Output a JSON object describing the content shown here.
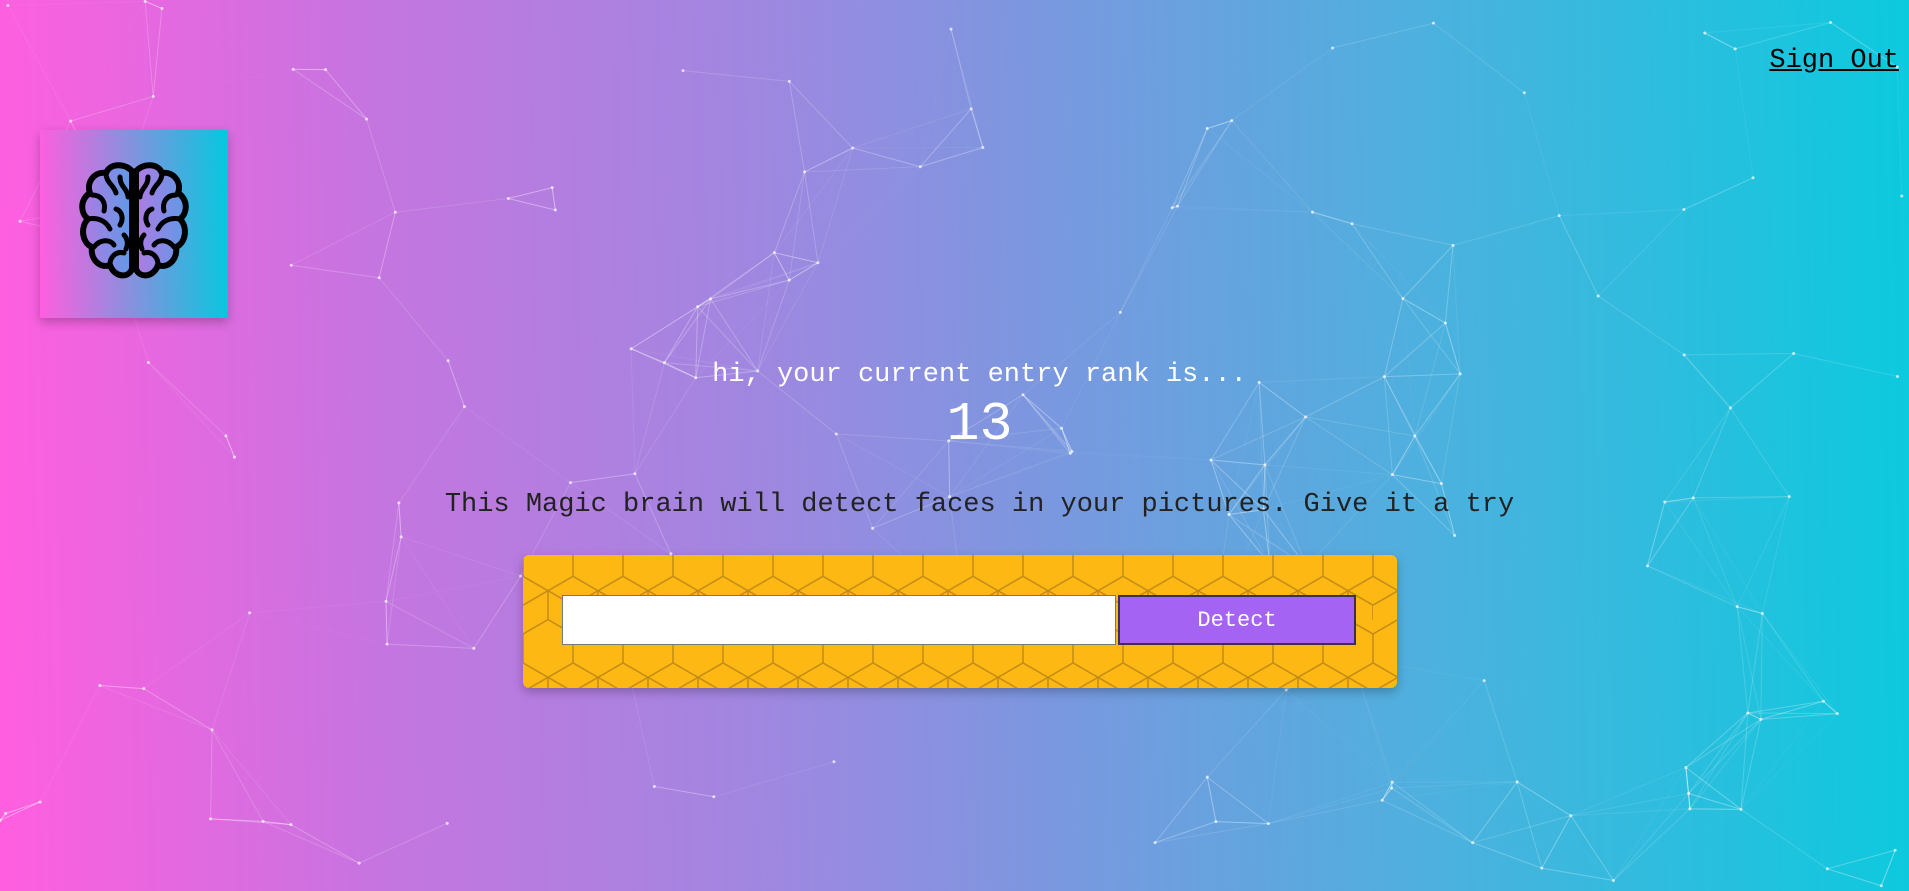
{
  "nav": {
    "sign_out_label": "Sign Out"
  },
  "logo": {
    "icon": "brain-icon"
  },
  "rank": {
    "greeting": "hi, your current entry rank is...",
    "value": "13"
  },
  "tagline": "This Magic brain will detect faces in your pictures. Give it a try",
  "form": {
    "input_value": "",
    "input_placeholder": "",
    "button_label": "Detect"
  },
  "colors": {
    "gradient_start": "#ff5edf",
    "gradient_end": "#04c8de",
    "panel": "#feb813",
    "button": "#a463f2"
  }
}
